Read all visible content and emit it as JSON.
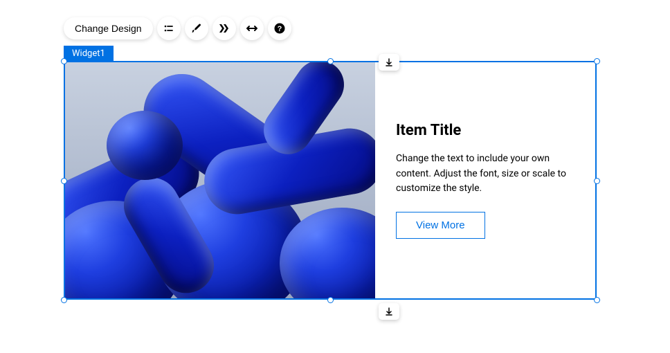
{
  "toolbar": {
    "change_design_label": "Change Design"
  },
  "widget": {
    "label": "Widget1",
    "title": "Item Title",
    "description": "Change the text to include your own content. Adjust the font, size or scale to customize the style.",
    "button_label": "View More"
  }
}
